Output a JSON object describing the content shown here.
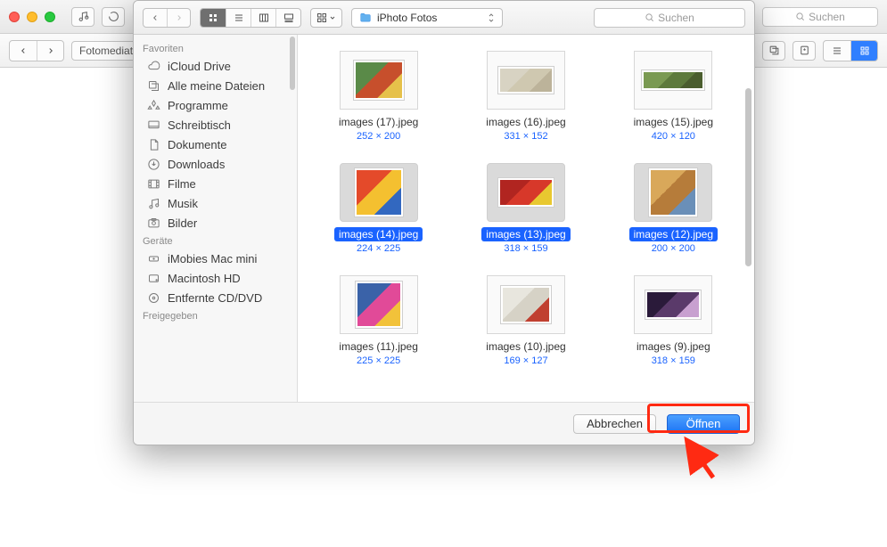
{
  "bg": {
    "search_placeholder": "Suchen",
    "breadcrumb": "Fotomediathe"
  },
  "dialog": {
    "path": {
      "folder_name": "iPhoto  Fotos"
    },
    "search_placeholder": "Suchen",
    "footer": {
      "cancel": "Abbrechen",
      "open": "Öffnen"
    }
  },
  "sidebar": {
    "sections": [
      {
        "title": "Favoriten",
        "items": [
          {
            "label": "iCloud Drive",
            "icon": "cloud"
          },
          {
            "label": "Alle meine Dateien",
            "icon": "all-files"
          },
          {
            "label": "Programme",
            "icon": "apps"
          },
          {
            "label": "Schreibtisch",
            "icon": "desktop"
          },
          {
            "label": "Dokumente",
            "icon": "documents"
          },
          {
            "label": "Downloads",
            "icon": "downloads"
          },
          {
            "label": "Filme",
            "icon": "movies"
          },
          {
            "label": "Musik",
            "icon": "music"
          },
          {
            "label": "Bilder",
            "icon": "pictures"
          }
        ]
      },
      {
        "title": "Geräte",
        "items": [
          {
            "label": "iMobies Mac mini",
            "icon": "mac"
          },
          {
            "label": "Macintosh HD",
            "icon": "hdd"
          },
          {
            "label": "Entfernte CD/DVD",
            "icon": "cd"
          }
        ]
      },
      {
        "title": "Freigegeben",
        "items": []
      }
    ]
  },
  "files": [
    {
      "name": "images (17).jpeg",
      "dim": "252 × 200",
      "selected": false,
      "w": 56,
      "h": 44,
      "colors": [
        "#5a8a48",
        "#c74f2c",
        "#e6c14a"
      ]
    },
    {
      "name": "images (16).jpeg",
      "dim": "331 × 152",
      "selected": false,
      "w": 62,
      "h": 30,
      "colors": [
        "#d8d3c3",
        "#cfc8b0",
        "#bcb39a"
      ]
    },
    {
      "name": "images (15).jpeg",
      "dim": "420 × 120",
      "selected": false,
      "w": 70,
      "h": 22,
      "colors": [
        "#7a9a52",
        "#5d7a3c",
        "#4a5d2e"
      ]
    },
    {
      "name": "images (14).jpeg",
      "dim": "224 × 225",
      "selected": true,
      "w": 54,
      "h": 54,
      "colors": [
        "#e44a2a",
        "#f4c030",
        "#3268c0"
      ]
    },
    {
      "name": "images (13).jpeg",
      "dim": "318 × 159",
      "selected": true,
      "w": 62,
      "h": 32,
      "colors": [
        "#b12520",
        "#d7382a",
        "#e8c830"
      ]
    },
    {
      "name": "images (12).jpeg",
      "dim": "200 × 200",
      "selected": true,
      "w": 54,
      "h": 54,
      "colors": [
        "#d9a85a",
        "#b67c3a",
        "#6a8fb8"
      ]
    },
    {
      "name": "images (11).jpeg",
      "dim": "225 × 225",
      "selected": false,
      "w": 52,
      "h": 52,
      "colors": [
        "#3a62a8",
        "#e14a98",
        "#f2c23a"
      ]
    },
    {
      "name": "images (10).jpeg",
      "dim": "169 × 127",
      "selected": false,
      "w": 56,
      "h": 42,
      "colors": [
        "#e8e6de",
        "#d6d2c6",
        "#c04030"
      ]
    },
    {
      "name": "images (9).jpeg",
      "dim": "318 × 159",
      "selected": false,
      "w": 62,
      "h": 32,
      "colors": [
        "#2a1a3a",
        "#5a3a6a",
        "#c8a0d0"
      ]
    }
  ]
}
